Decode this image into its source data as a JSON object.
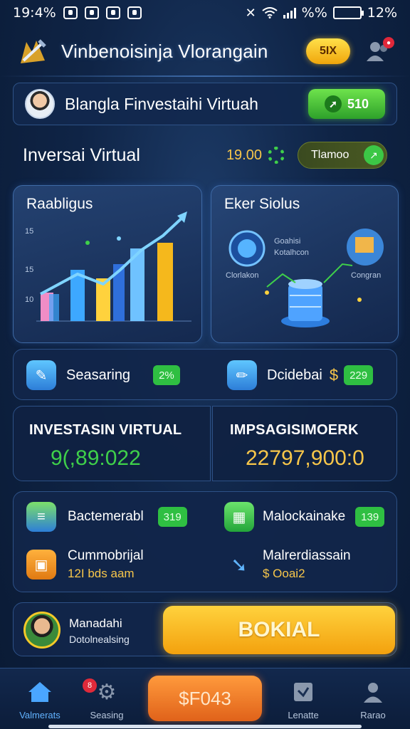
{
  "status_bar": {
    "time": "19:4%",
    "battery_text": "12%",
    "signal_text": "%%"
  },
  "app_bar": {
    "title": "Vinbenoisinja Vlorangain",
    "coin_label": "5IX"
  },
  "profile": {
    "name": "Blangla Finvestaihi Virtuah",
    "pill_value": "510"
  },
  "investasi": {
    "title": "Inversai Virtual",
    "value": "19.00",
    "pill_text": "Tlamoo"
  },
  "panels": {
    "left_title": "Raabligus",
    "left_axis_ticks": [
      "15",
      "15",
      "10"
    ],
    "right_title": "Eker Siolus",
    "right_labels": {
      "top": "Goahisi",
      "top2": "Kotalhcon",
      "left": "Clorlakon",
      "right": "Congran"
    }
  },
  "stats": [
    {
      "label": "Seasaring",
      "badge": "2%"
    },
    {
      "label": "Dcidebai",
      "badge": "229",
      "currency": "$"
    }
  ],
  "big_cards": [
    {
      "label": "INVESTASIN VIRTUAL",
      "value": "9(,89:022",
      "color": "#3fd04a"
    },
    {
      "label": "IMPSAGISIMOERK",
      "value": "22797,900:0",
      "color": "#f7c64a"
    }
  ],
  "list_items": [
    {
      "label": "Bactemerabl",
      "badge": "319"
    },
    {
      "label": "Malockainake",
      "badge": "139"
    },
    {
      "label": "Cummobrijal",
      "sub": "12I bds aam"
    },
    {
      "label": "Malrerdiassain",
      "sub": "$ Ooai2"
    }
  ],
  "cta": {
    "manager_name": "Manadahi",
    "manager_sub": "Dotolnealsing",
    "button_label": "BOKIAL"
  },
  "bottom_nav": {
    "items": [
      "Valmerats",
      "Seasing",
      "Lenatte",
      "Rarao"
    ],
    "center_label": "$F043",
    "badge": "8"
  },
  "colors": {
    "accent_gold": "#f7c64a",
    "accent_green": "#3fd04a",
    "background": "#0f2446"
  }
}
